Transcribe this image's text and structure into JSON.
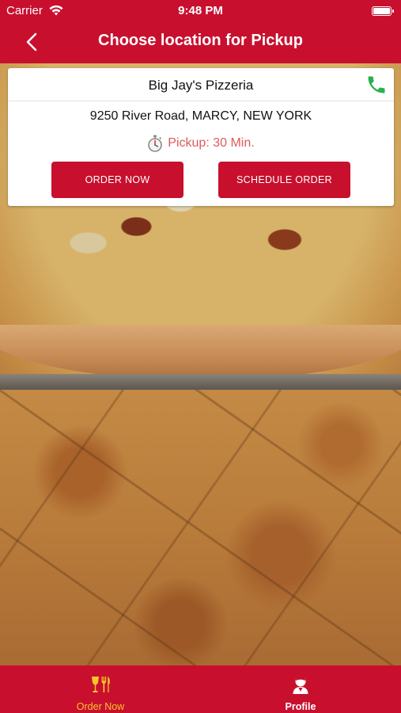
{
  "status_bar": {
    "carrier": "Carrier",
    "time": "9:48 PM"
  },
  "header": {
    "title": "Choose location for Pickup",
    "back_icon": "chevron-left-icon"
  },
  "location": {
    "name": "Big Jay's Pizzeria",
    "address": "9250 River Road, MARCY, NEW YORK",
    "pickup_text": "Pickup: 30 Min.",
    "order_now_label": "ORDER NOW",
    "schedule_order_label": "SCHEDULE ORDER",
    "phone_icon": "phone-icon",
    "phone_icon_color": "#2ab24a"
  },
  "tab_bar": {
    "tabs": [
      {
        "label": "Order Now",
        "icon": "utensils-glass-icon",
        "active": true
      },
      {
        "label": "Profile",
        "icon": "user-icon",
        "active": false
      }
    ]
  },
  "colors": {
    "brand_red": "#c8102e",
    "active_tab": "#f7c52b",
    "pickup_text": "#e05a5a"
  }
}
